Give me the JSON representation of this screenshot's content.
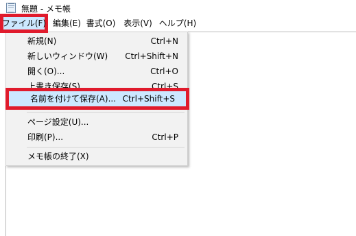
{
  "window": {
    "title": "無題 - メモ帳"
  },
  "menubar": {
    "file": "ファイル(F)",
    "edit": "編集(E)",
    "format": "書式(O)",
    "view": "表示(V)",
    "help": "ヘルプ(H)"
  },
  "file_menu": {
    "items": [
      {
        "label": "新規(N)",
        "shortcut": "Ctrl+N"
      },
      {
        "label": "新しいウィンドウ(W)",
        "shortcut": "Ctrl+Shift+N"
      },
      {
        "label": "開く(O)...",
        "shortcut": "Ctrl+O"
      },
      {
        "label": "上書き保存(S)",
        "shortcut": "Ctrl+S"
      },
      {
        "label": "名前を付けて保存(A)...",
        "shortcut": "Ctrl+Shift+S"
      },
      {
        "label": "ページ設定(U)...",
        "shortcut": ""
      },
      {
        "label": "印刷(P)...",
        "shortcut": "Ctrl+P"
      },
      {
        "label": "メモ帳の終了(X)",
        "shortcut": ""
      }
    ]
  },
  "colors": {
    "highlight_border": "#e01b2c",
    "selection_background": "#cce8ff"
  },
  "icons": {
    "app": "notepad-icon"
  }
}
